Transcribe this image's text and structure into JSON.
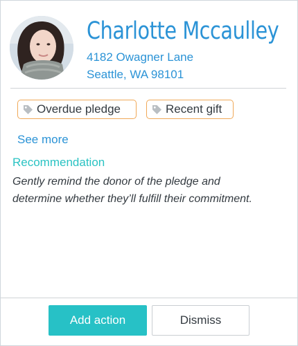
{
  "donor": {
    "name": "Charlotte Mccaulley",
    "address_line1": "4182 Owagner Lane",
    "address_line2": "Seattle, WA 98101"
  },
  "tags": [
    {
      "label": "Overdue pledge",
      "icon": "tag-icon"
    },
    {
      "label": "Recent gift",
      "icon": "tag-icon"
    }
  ],
  "see_more_label": "See more",
  "recommendation": {
    "title": "Recommendation",
    "text": "Gently remind the donor of the pledge and determine whether they’ll fulfill their commitment."
  },
  "actions": {
    "primary_label": "Add action",
    "secondary_label": "Dismiss"
  },
  "colors": {
    "accent_blue": "#2b93d6",
    "accent_teal": "#27c1c6",
    "tag_border": "#f0a857"
  }
}
